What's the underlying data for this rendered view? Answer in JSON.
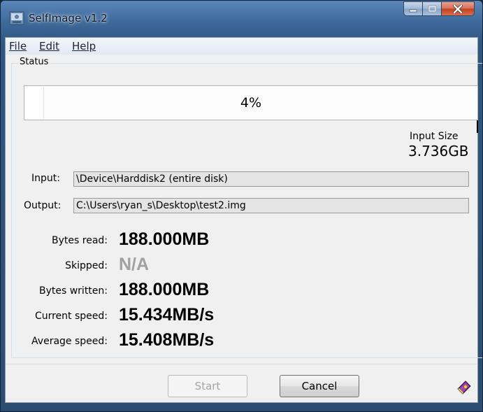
{
  "window": {
    "title": "SelfImage v1.2"
  },
  "menu": [
    "File",
    "Edit",
    "Help"
  ],
  "status": {
    "group_label": "Status",
    "progress_percent": 4,
    "progress_text": "4%",
    "input_size_label": "Input Size",
    "input_size_value": "3.736GB",
    "input_label": "Input:",
    "input_value": "\\Device\\Harddisk2 (entire disk)",
    "output_label": "Output:",
    "output_value": "C:\\Users\\ryan_s\\Desktop\\test2.img"
  },
  "stats": [
    {
      "label": "Bytes read:",
      "value": "188.000MB"
    },
    {
      "label": "Skipped:",
      "value": "N/A"
    },
    {
      "label": "Bytes written:",
      "value": "188.000MB"
    },
    {
      "label": "Current speed:",
      "value": "15.434MB/s"
    },
    {
      "label": "Average speed:",
      "value": "15.408MB/s"
    }
  ],
  "buttons": {
    "start": "Start",
    "cancel": "Cancel"
  },
  "icons": {
    "app": "selfimage-app-icon",
    "help": "help-book-icon"
  },
  "colors": {
    "titlebar": "#3e6a9c",
    "client": "#f0f0f0",
    "close_button": "#c23f21"
  }
}
